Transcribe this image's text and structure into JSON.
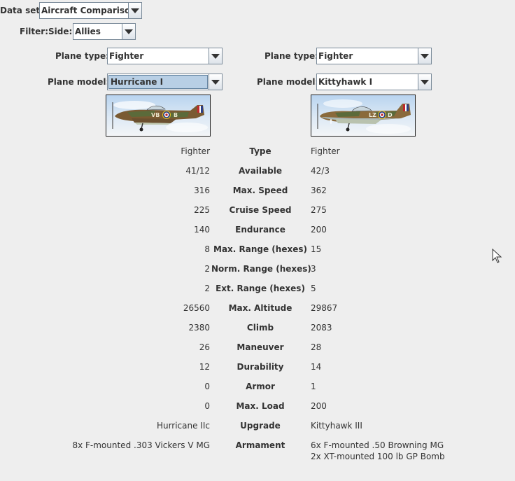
{
  "toolbar": {
    "dataset_label": "Data set:",
    "dataset_value": "Aircraft Comparison",
    "filter_label": "Filter:",
    "side_label": "Side:",
    "side_value": "Allies"
  },
  "left": {
    "plane_type_label": "Plane type:",
    "plane_type_value": "Fighter",
    "plane_model_label": "Plane model:",
    "plane_model_value": "Hurricane I",
    "plane_code": "VB ⊕ B"
  },
  "right": {
    "plane_type_label": "Plane type:",
    "plane_type_value": "Fighter",
    "plane_model_label": "Plane model:",
    "plane_model_value": "Kittyhawk I",
    "plane_code": "LZ ⊕ D"
  },
  "comparison": [
    {
      "label": "Type",
      "left": "Fighter",
      "right": "Fighter"
    },
    {
      "label": "Available",
      "left": "41/12",
      "right": "42/3"
    },
    {
      "label": "Max. Speed",
      "left": "316",
      "right": "362"
    },
    {
      "label": "Cruise Speed",
      "left": "225",
      "right": "275"
    },
    {
      "label": "Endurance",
      "left": "140",
      "right": "200"
    },
    {
      "label": "Max. Range (hexes)",
      "left": "8",
      "right": "15"
    },
    {
      "label": "Norm. Range (hexes)",
      "left": "2",
      "right": "3"
    },
    {
      "label": "Ext. Range (hexes)",
      "left": "2",
      "right": "5"
    },
    {
      "label": "Max. Altitude",
      "left": "26560",
      "right": "29867"
    },
    {
      "label": "Climb",
      "left": "2380",
      "right": "2083"
    },
    {
      "label": "Maneuver",
      "left": "26",
      "right": "28"
    },
    {
      "label": "Durability",
      "left": "12",
      "right": "14"
    },
    {
      "label": "Armor",
      "left": "0",
      "right": "1"
    },
    {
      "label": "Max. Load",
      "left": "0",
      "right": "200"
    },
    {
      "label": "Upgrade",
      "left": "Hurricane IIc",
      "right": "Kittyhawk III"
    },
    {
      "label": "Armament",
      "left": "8x F-mounted .303 Vickers V MG",
      "right": "6x F-mounted .50 Browning MG\n2x XT-mounted 100 lb GP Bomb"
    }
  ],
  "colors": {
    "background": "#eeeeee",
    "selection": "#b8cfe5",
    "camo_brown": "#7a5a32",
    "camo_green": "#5b6a3a",
    "roundel_red": "#c0282d",
    "roundel_blue": "#2c3f86"
  },
  "icons": {
    "dropdown": "chevron-down-icon",
    "cursor": "mouse-pointer-icon"
  }
}
